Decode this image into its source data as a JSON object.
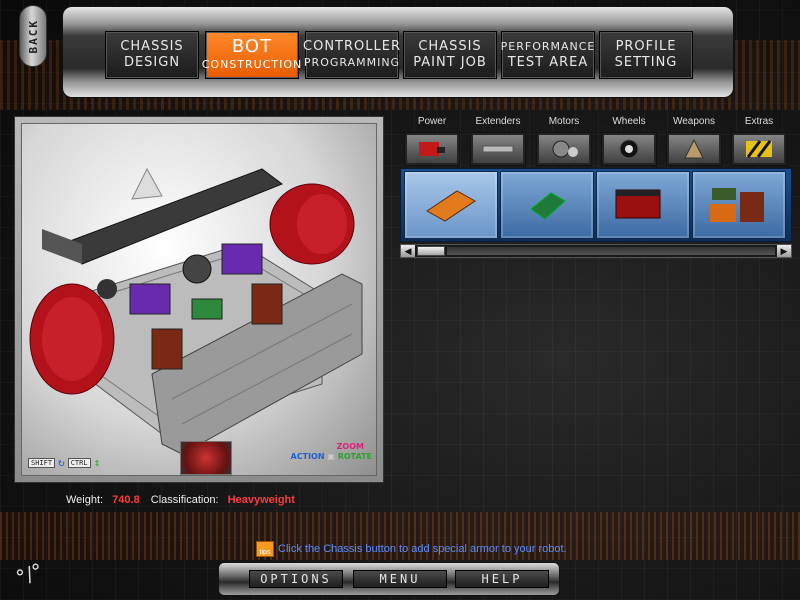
{
  "nav": {
    "back_label": "BACK",
    "tabs": [
      {
        "l1": "CHASSIS",
        "l2": "DESIGN"
      },
      {
        "l1": "BOT",
        "l2": "CONSTRUCTION"
      },
      {
        "l1": "CONTROLLER",
        "l2": "PROGRAMMING"
      },
      {
        "l1": "CHASSIS",
        "l2": "PAINT JOB"
      },
      {
        "l1": "PERFORMANCE",
        "l2": "TEST AREA"
      },
      {
        "l1": "PROFILE",
        "l2": "SETTING"
      }
    ],
    "active_tab": "BOT CONSTRUCTION"
  },
  "preview": {
    "shift_key": "SHIFT",
    "ctrl_key": "CTRL",
    "zoom_label": "ZOOM",
    "action_label": "ACTION",
    "rotate_label": "ROTATE"
  },
  "stats": {
    "weight_label": "Weight:",
    "weight_value": "740.8",
    "class_label": "Classification:",
    "class_value": "Heavyweight"
  },
  "parts": {
    "categories": [
      "Power",
      "Extenders",
      "Motors",
      "Wheels",
      "Weapons",
      "Extras"
    ],
    "tray_items": [
      "orange-battery-pack",
      "green-circuit-board",
      "red-battery-block",
      "battery-cells"
    ]
  },
  "tip": {
    "icon_label": "tips",
    "text": "Click the Chassis button to add special armor to your robot."
  },
  "menu": {
    "options": "OPTIONS",
    "menu": "MENU",
    "help": "HELP"
  },
  "colors": {
    "accent": "#f07a1a",
    "stat_value": "#ff3b3b",
    "tip_text": "#5a8cff",
    "tray_blue": "#1b4f8c"
  }
}
